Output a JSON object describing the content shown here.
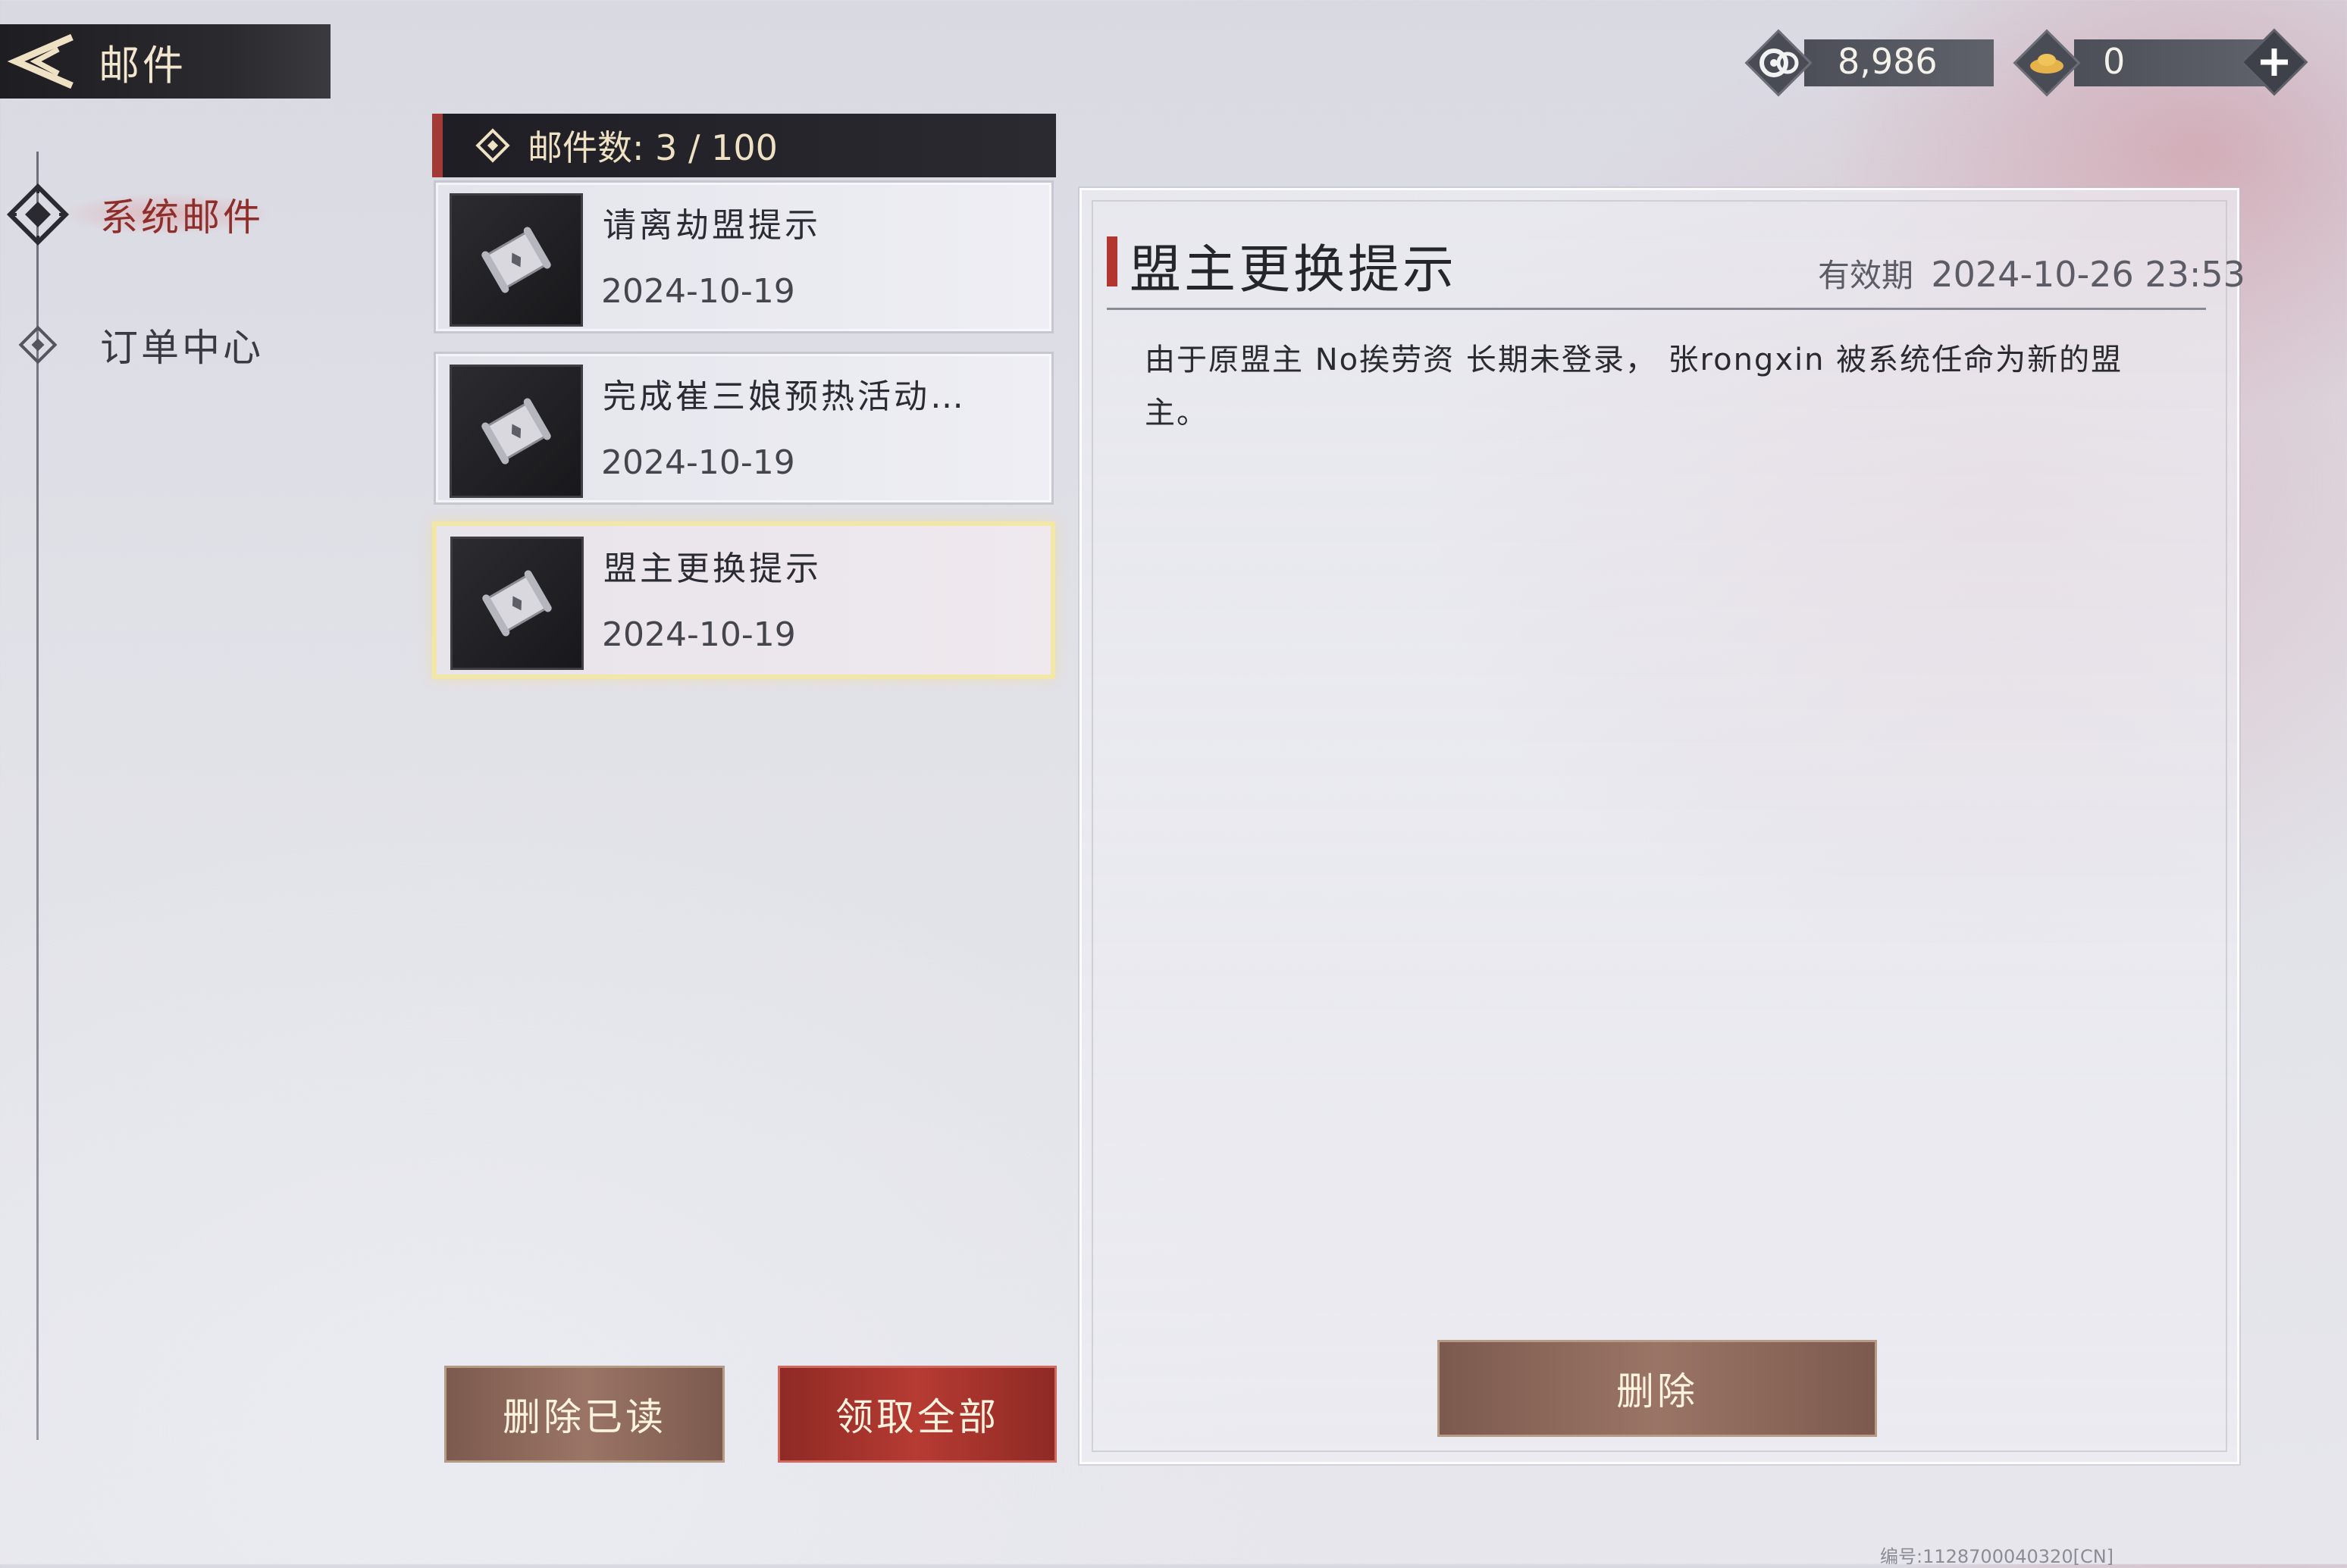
{
  "header": {
    "title": "邮件",
    "back_icon": "back-arrow-icon"
  },
  "currency": {
    "silver_icon": "silver-coin-icon",
    "silver_value": "8,986",
    "ingot_icon": "gold-ingot-icon",
    "ingot_value": "0",
    "add_icon": "plus-icon"
  },
  "sidebar": {
    "items": [
      {
        "label": "系统邮件",
        "icon": "diamond-emblem-icon",
        "active": true
      },
      {
        "label": "订单中心",
        "icon": "diamond-small-icon",
        "active": false
      }
    ]
  },
  "mail_list": {
    "count_label": "邮件数: 3 / 100",
    "items": [
      {
        "title": "请离劫盟提示",
        "date": "2024-10-19",
        "icon": "scroll-icon",
        "selected": false
      },
      {
        "title": "完成崔三娘预热活动…",
        "date": "2024-10-19",
        "icon": "scroll-icon",
        "selected": false
      },
      {
        "title": "盟主更换提示",
        "date": "2024-10-19",
        "icon": "scroll-icon",
        "selected": true
      }
    ],
    "delete_read_label": "删除已读",
    "claim_all_label": "领取全部"
  },
  "detail": {
    "title": "盟主更换提示",
    "validity_label": "有效期",
    "validity_value": "2024-10-26 23:53",
    "body": "由于原盟主 No挨劳资 长期未登录， 张rongxin 被系统任命为新的盟主。",
    "delete_label": "删除"
  },
  "footer": {
    "code": "编号:1128700040320[CN]"
  },
  "colors": {
    "accent_red": "#b3352f",
    "title_bar": "#1e1e22",
    "gold_text": "#efe1c4",
    "selected_border": "#f2e7a6"
  }
}
